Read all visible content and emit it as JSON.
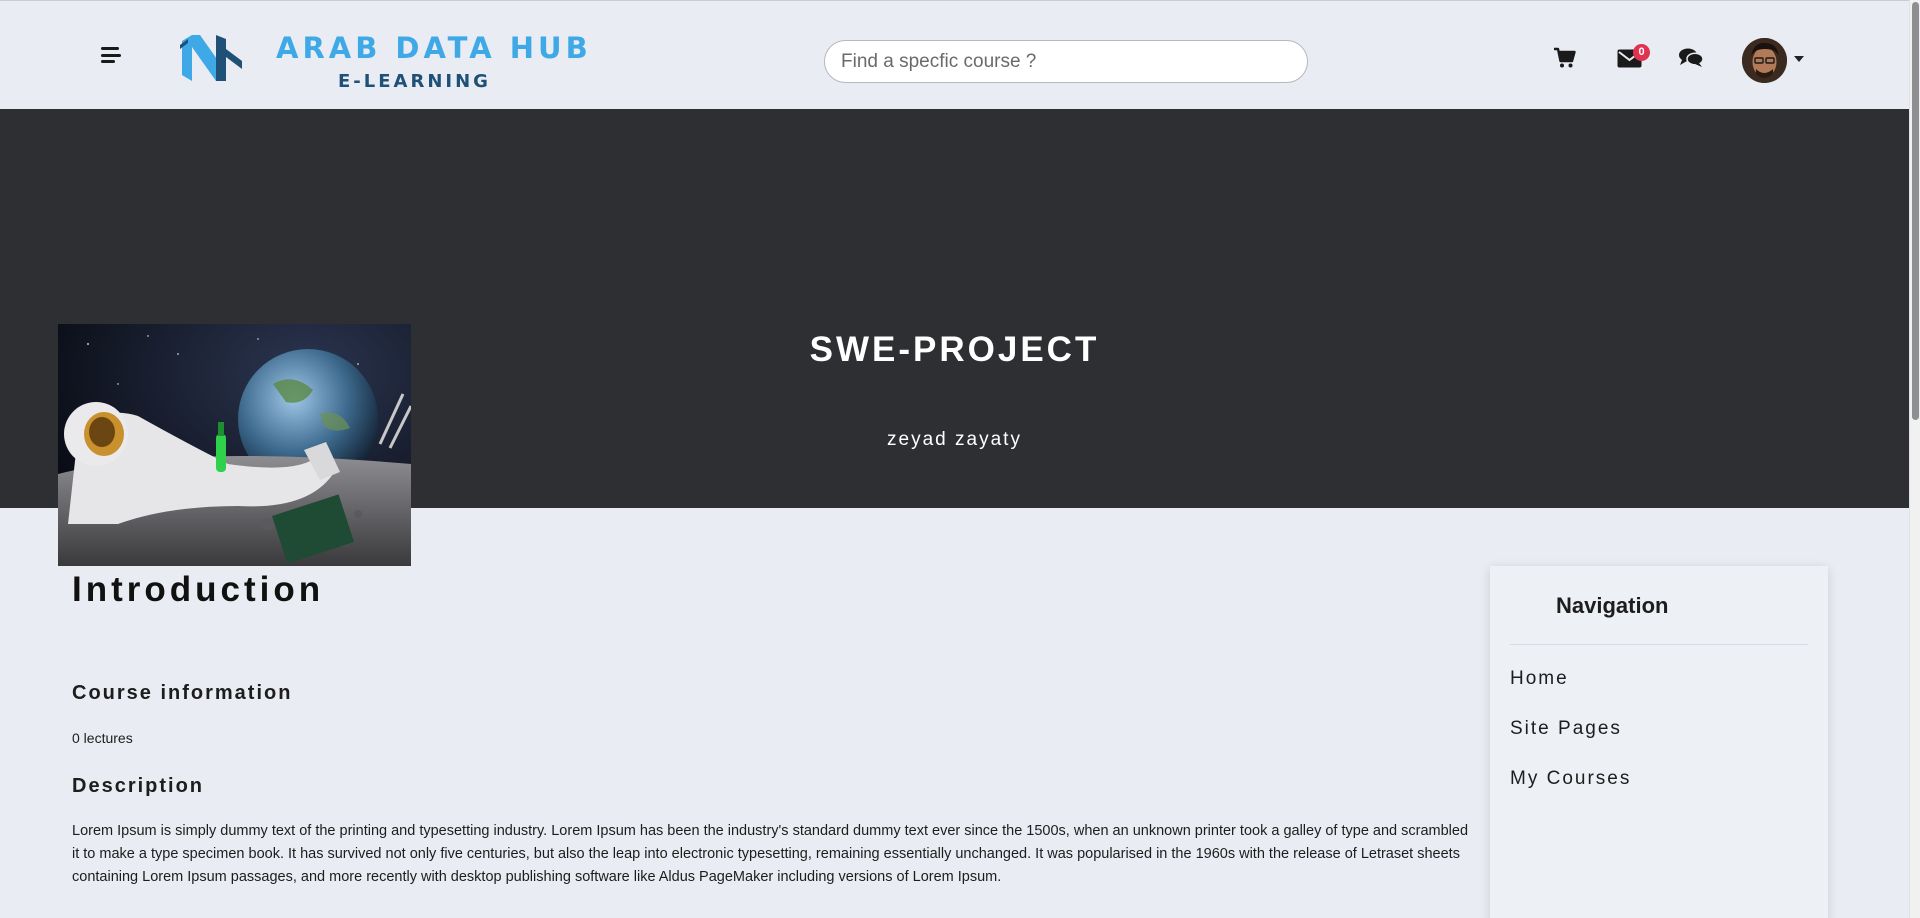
{
  "navbar": {
    "menu_icon": "hamburger-menu-icon",
    "logo": {
      "line1": "ARAB DATA HUB",
      "line2": "E-LEARNING"
    },
    "search": {
      "placeholder": "Find a specfic course ?",
      "value": ""
    },
    "icons": [
      "cart-icon",
      "envelope-icon",
      "chat-bubbles-icon"
    ],
    "messages_badge": "0",
    "user_menu_icon": "caret-down-icon"
  },
  "hero": {
    "title": "SWE-PROJECT",
    "author": "zeyad zayaty",
    "image_icon": "astronaut-on-moon-image"
  },
  "content": {
    "intro_heading": "Introduction",
    "course_info_heading": "Course information",
    "lectures": "0 lectures",
    "description_heading": "Description",
    "description": "Lorem Ipsum is simply dummy text of the printing and typesetting industry. Lorem Ipsum has been the industry's standard dummy text ever since the 1500s, when an unknown printer took a galley of type and scrambled it to make a type specimen book. It has survived not only five centuries, but also the leap into electronic typesetting, remaining essentially unchanged. It was popularised in the 1960s with the release of Letraset sheets containing Lorem Ipsum passages, and more recently with desktop publishing software like Aldus PageMaker including versions of Lorem Ipsum."
  },
  "sidebar_nav": {
    "title": "Navigation",
    "items": [
      {
        "label": "Home"
      },
      {
        "label": "Site Pages"
      },
      {
        "label": "My Courses"
      }
    ]
  },
  "colors": {
    "page_bg": "#e9ecf2",
    "hero_bg": "#2e2f32",
    "logo_primary": "#3ea9e6",
    "logo_secondary": "#1f5078",
    "badge": "#e0334f"
  }
}
